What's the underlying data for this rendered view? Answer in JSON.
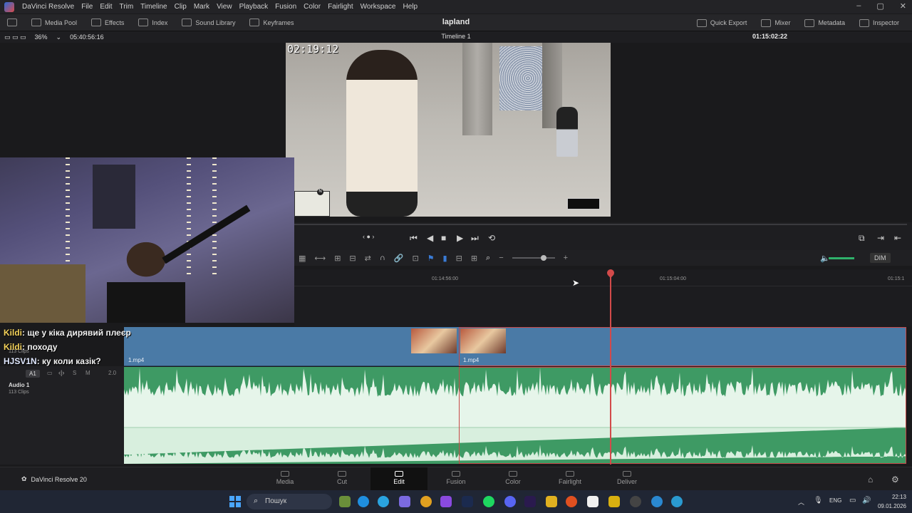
{
  "menubar": {
    "app_name": "DaVinci Resolve",
    "items": [
      "File",
      "Edit",
      "Trim",
      "Timeline",
      "Clip",
      "Mark",
      "View",
      "Playback",
      "Fusion",
      "Color",
      "Fairlight",
      "Workspace",
      "Help"
    ]
  },
  "toolbar": {
    "media_pool": "Media Pool",
    "effects": "Effects",
    "index": "Index",
    "sound_library": "Sound Library",
    "keyframes": "Keyframes",
    "project_title": "lapland",
    "quick_export": "Quick Export",
    "mixer": "Mixer",
    "metadata": "Metadata",
    "inspector": "Inspector"
  },
  "viewer_bar": {
    "zoom": "36%",
    "source_timecode": "05:40:56:16",
    "timeline_name": "Timeline 1",
    "record_timecode": "01:15:02:22"
  },
  "viewer": {
    "overlay_timecode": "02:19:12",
    "minimap_letter": "N"
  },
  "timeline_toolbar": {
    "dim_label": "DIM"
  },
  "ruler": {
    "ticks": [
      "01:14:56:00",
      "01:15:04:00",
      "01:15:1"
    ]
  },
  "video_track": {
    "clip_name_1": "1.mp4",
    "clip_name_2": "1.mp4"
  },
  "audio_track": {
    "badge": "A1",
    "s_label": "S",
    "m_label": "M",
    "level": "2.0",
    "name": "Audio 1",
    "clips": "113 Clips"
  },
  "chat": {
    "messages": [
      {
        "user": "Kildi",
        "text": "ще у кіка дирявий плеєр"
      },
      {
        "user": "Kildi",
        "text": "походу"
      },
      {
        "user": "HJSV1N",
        "text": "ку коли казік?"
      }
    ],
    "underlay_text": "113 Clips"
  },
  "page_tabs": {
    "brand": "DaVinci Resolve 20",
    "tabs": [
      "Media",
      "Cut",
      "Edit",
      "Fusion",
      "Color",
      "Fairlight",
      "Deliver"
    ],
    "active": "Edit"
  },
  "taskbar": {
    "search_placeholder": "Пошук",
    "lang": "ENG",
    "time": "22:13",
    "date": "09.01.2026"
  },
  "colors": {
    "video_track": "#4a7aa6",
    "audio_track": "#3e9a64",
    "playhead": "#d24a4a"
  }
}
